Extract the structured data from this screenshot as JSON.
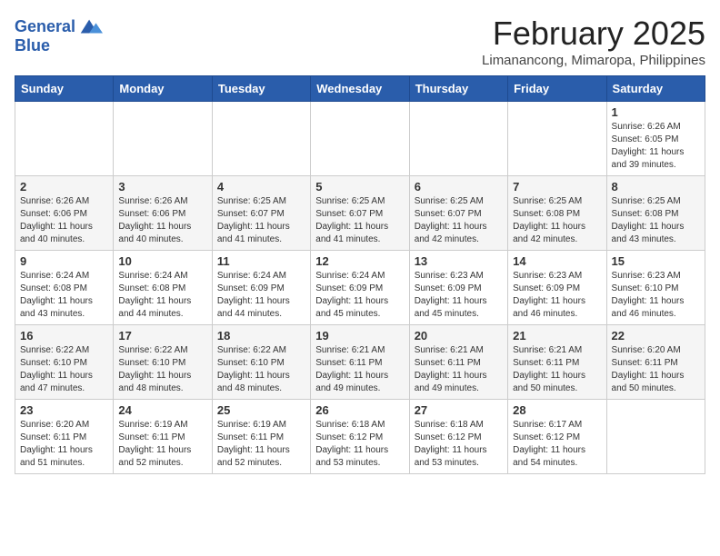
{
  "header": {
    "logo_line1": "General",
    "logo_line2": "Blue",
    "month_title": "February 2025",
    "location": "Limanancong, Mimaropa, Philippines"
  },
  "weekdays": [
    "Sunday",
    "Monday",
    "Tuesday",
    "Wednesday",
    "Thursday",
    "Friday",
    "Saturday"
  ],
  "weeks": [
    [
      {
        "day": "",
        "info": ""
      },
      {
        "day": "",
        "info": ""
      },
      {
        "day": "",
        "info": ""
      },
      {
        "day": "",
        "info": ""
      },
      {
        "day": "",
        "info": ""
      },
      {
        "day": "",
        "info": ""
      },
      {
        "day": "1",
        "info": "Sunrise: 6:26 AM\nSunset: 6:05 PM\nDaylight: 11 hours\nand 39 minutes."
      }
    ],
    [
      {
        "day": "2",
        "info": "Sunrise: 6:26 AM\nSunset: 6:06 PM\nDaylight: 11 hours\nand 40 minutes."
      },
      {
        "day": "3",
        "info": "Sunrise: 6:26 AM\nSunset: 6:06 PM\nDaylight: 11 hours\nand 40 minutes."
      },
      {
        "day": "4",
        "info": "Sunrise: 6:25 AM\nSunset: 6:07 PM\nDaylight: 11 hours\nand 41 minutes."
      },
      {
        "day": "5",
        "info": "Sunrise: 6:25 AM\nSunset: 6:07 PM\nDaylight: 11 hours\nand 41 minutes."
      },
      {
        "day": "6",
        "info": "Sunrise: 6:25 AM\nSunset: 6:07 PM\nDaylight: 11 hours\nand 42 minutes."
      },
      {
        "day": "7",
        "info": "Sunrise: 6:25 AM\nSunset: 6:08 PM\nDaylight: 11 hours\nand 42 minutes."
      },
      {
        "day": "8",
        "info": "Sunrise: 6:25 AM\nSunset: 6:08 PM\nDaylight: 11 hours\nand 43 minutes."
      }
    ],
    [
      {
        "day": "9",
        "info": "Sunrise: 6:24 AM\nSunset: 6:08 PM\nDaylight: 11 hours\nand 43 minutes."
      },
      {
        "day": "10",
        "info": "Sunrise: 6:24 AM\nSunset: 6:08 PM\nDaylight: 11 hours\nand 44 minutes."
      },
      {
        "day": "11",
        "info": "Sunrise: 6:24 AM\nSunset: 6:09 PM\nDaylight: 11 hours\nand 44 minutes."
      },
      {
        "day": "12",
        "info": "Sunrise: 6:24 AM\nSunset: 6:09 PM\nDaylight: 11 hours\nand 45 minutes."
      },
      {
        "day": "13",
        "info": "Sunrise: 6:23 AM\nSunset: 6:09 PM\nDaylight: 11 hours\nand 45 minutes."
      },
      {
        "day": "14",
        "info": "Sunrise: 6:23 AM\nSunset: 6:09 PM\nDaylight: 11 hours\nand 46 minutes."
      },
      {
        "day": "15",
        "info": "Sunrise: 6:23 AM\nSunset: 6:10 PM\nDaylight: 11 hours\nand 46 minutes."
      }
    ],
    [
      {
        "day": "16",
        "info": "Sunrise: 6:22 AM\nSunset: 6:10 PM\nDaylight: 11 hours\nand 47 minutes."
      },
      {
        "day": "17",
        "info": "Sunrise: 6:22 AM\nSunset: 6:10 PM\nDaylight: 11 hours\nand 48 minutes."
      },
      {
        "day": "18",
        "info": "Sunrise: 6:22 AM\nSunset: 6:10 PM\nDaylight: 11 hours\nand 48 minutes."
      },
      {
        "day": "19",
        "info": "Sunrise: 6:21 AM\nSunset: 6:11 PM\nDaylight: 11 hours\nand 49 minutes."
      },
      {
        "day": "20",
        "info": "Sunrise: 6:21 AM\nSunset: 6:11 PM\nDaylight: 11 hours\nand 49 minutes."
      },
      {
        "day": "21",
        "info": "Sunrise: 6:21 AM\nSunset: 6:11 PM\nDaylight: 11 hours\nand 50 minutes."
      },
      {
        "day": "22",
        "info": "Sunrise: 6:20 AM\nSunset: 6:11 PM\nDaylight: 11 hours\nand 50 minutes."
      }
    ],
    [
      {
        "day": "23",
        "info": "Sunrise: 6:20 AM\nSunset: 6:11 PM\nDaylight: 11 hours\nand 51 minutes."
      },
      {
        "day": "24",
        "info": "Sunrise: 6:19 AM\nSunset: 6:11 PM\nDaylight: 11 hours\nand 52 minutes."
      },
      {
        "day": "25",
        "info": "Sunrise: 6:19 AM\nSunset: 6:11 PM\nDaylight: 11 hours\nand 52 minutes."
      },
      {
        "day": "26",
        "info": "Sunrise: 6:18 AM\nSunset: 6:12 PM\nDaylight: 11 hours\nand 53 minutes."
      },
      {
        "day": "27",
        "info": "Sunrise: 6:18 AM\nSunset: 6:12 PM\nDaylight: 11 hours\nand 53 minutes."
      },
      {
        "day": "28",
        "info": "Sunrise: 6:17 AM\nSunset: 6:12 PM\nDaylight: 11 hours\nand 54 minutes."
      },
      {
        "day": "",
        "info": ""
      }
    ]
  ]
}
